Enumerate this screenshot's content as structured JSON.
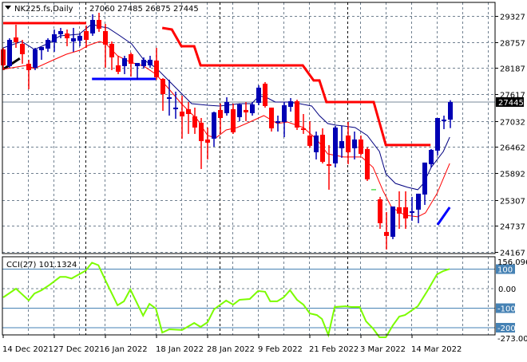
{
  "header": {
    "symbol": "NK225.fs,Daily",
    "ohlc": "27060 27485 26875 27445"
  },
  "colors": {
    "bull": "#0000b4",
    "bear": "#ff0000",
    "ma_fast": "#000080",
    "ma_slow": "#ff0000",
    "cci": "#7cfc00",
    "level": "#4682b4",
    "grid": "#708090"
  },
  "chart_data": [
    {
      "type": "candlestick",
      "title": "NK225.fs,Daily",
      "ylim": [
        24167,
        29327
      ],
      "yticks": [
        "29327",
        "28757",
        "28187",
        "27617",
        "27032",
        "26462",
        "25892",
        "25307",
        "24737",
        "24167"
      ],
      "current_price": "27445",
      "xticks": [
        {
          "index": 0,
          "label": "14 Dec 2021"
        },
        {
          "index": 8,
          "label": "27 Dec 2021"
        },
        {
          "index": 16,
          "label": "6 Jan 2022"
        },
        {
          "index": 24,
          "label": "18 Jan 2022"
        },
        {
          "index": 32,
          "label": "28 Jan 2022"
        },
        {
          "index": 40,
          "label": "9 Feb 2022"
        },
        {
          "index": 48,
          "label": "21 Feb 2022"
        },
        {
          "index": 56,
          "label": "3 Mar 2022"
        },
        {
          "index": 64,
          "label": "14 Mar 2022"
        }
      ],
      "month_separators": [
        12.9,
        33.9,
        53.9
      ],
      "candles": [
        [
          28595,
          28630,
          28143,
          28247
        ],
        [
          28230,
          28839,
          28195,
          28804
        ],
        [
          28857,
          29136,
          28630,
          28752
        ],
        [
          28717,
          28804,
          28282,
          28491
        ],
        [
          28282,
          28369,
          27724,
          28143
        ],
        [
          28195,
          28630,
          28143,
          28595
        ],
        [
          28578,
          28647,
          28369,
          28647
        ],
        [
          28613,
          28839,
          28543,
          28804
        ],
        [
          28752,
          29031,
          28543,
          28927
        ],
        [
          28927,
          29066,
          28839,
          28996
        ],
        [
          28944,
          29031,
          28665,
          28839
        ],
        [
          28769,
          29066,
          28543,
          28839
        ],
        [
          28787,
          28944,
          28665,
          28892
        ],
        [
          28996,
          29118,
          28630,
          28804
        ],
        [
          28944,
          29362,
          28892,
          29240
        ],
        [
          29240,
          29397,
          28979,
          29048
        ],
        [
          28996,
          29153,
          28195,
          28700
        ],
        [
          28717,
          28769,
          28143,
          28421
        ],
        [
          28247,
          28456,
          28055,
          28107
        ],
        [
          28230,
          28456,
          28055,
          28404
        ],
        [
          28491,
          28526,
          28003,
          28282
        ],
        [
          28230,
          28299,
          27933,
          28299
        ],
        [
          28230,
          28421,
          28178,
          28369
        ],
        [
          28247,
          28456,
          28195,
          28369
        ],
        [
          28352,
          28630,
          27933,
          27985
        ],
        [
          27950,
          27968,
          27253,
          27619
        ],
        [
          27515,
          27933,
          27148,
          27549
        ],
        [
          27288,
          27672,
          27079,
          27323
        ],
        [
          27236,
          27584,
          26644,
          27131
        ],
        [
          27288,
          27445,
          26748,
          27183
        ],
        [
          27131,
          27323,
          26748,
          26887
        ],
        [
          26992,
          27096,
          25981,
          26591
        ],
        [
          26626,
          26887,
          26190,
          26556
        ],
        [
          26644,
          27236,
          26469,
          27219
        ],
        [
          27271,
          27410,
          26765,
          27096
        ],
        [
          27201,
          27549,
          27148,
          27445
        ],
        [
          27288,
          27410,
          26748,
          26783
        ],
        [
          27114,
          27410,
          27026,
          27393
        ],
        [
          27271,
          27445,
          27026,
          27219
        ],
        [
          27201,
          27445,
          27148,
          27393
        ],
        [
          27427,
          27811,
          27375,
          27759
        ],
        [
          27846,
          27881,
          27323,
          27358
        ],
        [
          27323,
          27323,
          26800,
          26870
        ],
        [
          26992,
          27148,
          26800,
          27026
        ],
        [
          27009,
          27445,
          26678,
          27375
        ],
        [
          27340,
          27532,
          27236,
          27462
        ],
        [
          27462,
          27497,
          26835,
          26887
        ],
        [
          26870,
          27183,
          26748,
          26835
        ],
        [
          26713,
          27026,
          26452,
          26487
        ],
        [
          26347,
          26800,
          26190,
          26713
        ],
        [
          26730,
          26870,
          26103,
          26138
        ],
        [
          26086,
          26504,
          25528,
          26068
        ],
        [
          26103,
          26922,
          26016,
          26887
        ],
        [
          26434,
          26922,
          26225,
          26591
        ],
        [
          26713,
          27009,
          26086,
          26347
        ],
        [
          26434,
          26800,
          26190,
          26626
        ],
        [
          26626,
          26713,
          26277,
          26312
        ],
        [
          26417,
          26452,
          25719,
          25754
        ],
        [
          25528,
          25528,
          25528,
          25528
        ],
        [
          25318,
          25371,
          24673,
          24796
        ],
        [
          24604,
          25040,
          24221,
          24517
        ],
        [
          24499,
          25161,
          24447,
          25161
        ],
        [
          25144,
          25493,
          24673,
          25005
        ],
        [
          25144,
          25493,
          24673,
          24900
        ],
        [
          25022,
          25371,
          24848,
          25057
        ],
        [
          25092,
          25441,
          24796,
          25441
        ],
        [
          25423,
          26121,
          25196,
          26121
        ],
        [
          26086,
          26417,
          26016,
          26399
        ],
        [
          26382,
          27096,
          26277,
          27096
        ],
        [
          27026,
          27148,
          26852,
          27061
        ],
        [
          27060,
          27485,
          26875,
          27445
        ]
      ],
      "neutral_candles": [
        58
      ],
      "ma_fast": [
        [
          0,
          28630
        ],
        [
          2.9,
          28769
        ],
        [
          4.9,
          28595
        ],
        [
          6.9,
          28717
        ],
        [
          8.9,
          28892
        ],
        [
          11.9,
          28927
        ],
        [
          13.9,
          29153
        ],
        [
          14.9,
          29100
        ],
        [
          16.4,
          29066
        ],
        [
          18.3,
          28892
        ],
        [
          20.1,
          28717
        ],
        [
          22,
          28369
        ],
        [
          23.9,
          28195
        ],
        [
          27,
          27759
        ],
        [
          29.5,
          27410
        ],
        [
          32,
          27375
        ],
        [
          33.9,
          27358
        ],
        [
          37,
          27410
        ],
        [
          38.9,
          27410
        ],
        [
          40.1,
          27584
        ],
        [
          41.4,
          27532
        ],
        [
          42.6,
          27445
        ],
        [
          44.5,
          27445
        ],
        [
          46.4,
          27410
        ],
        [
          48.3,
          27358
        ],
        [
          49.5,
          27148
        ],
        [
          50.8,
          26975
        ],
        [
          52,
          26940
        ],
        [
          53.3,
          26922
        ],
        [
          55.1,
          26887
        ],
        [
          57,
          26713
        ],
        [
          58.9,
          26364
        ],
        [
          59.9,
          25876
        ],
        [
          61.4,
          25667
        ],
        [
          63.3,
          25580
        ],
        [
          64.9,
          25528
        ],
        [
          65.8,
          25667
        ],
        [
          67,
          26016
        ],
        [
          68.9,
          26364
        ],
        [
          69.9,
          26678
        ]
      ],
      "ma_slow": [
        [
          0,
          28160
        ],
        [
          3.6,
          28247
        ],
        [
          4.9,
          28178
        ],
        [
          7.9,
          28369
        ],
        [
          9.9,
          28491
        ],
        [
          12,
          28578
        ],
        [
          13.3,
          28682
        ],
        [
          15.1,
          28769
        ],
        [
          16.1,
          28717
        ],
        [
          17.9,
          28456
        ],
        [
          19.9,
          28317
        ],
        [
          22,
          28230
        ],
        [
          23.9,
          28055
        ],
        [
          26.1,
          27706
        ],
        [
          27.9,
          27410
        ],
        [
          30.4,
          27061
        ],
        [
          32,
          26713
        ],
        [
          33.3,
          26661
        ],
        [
          34.9,
          26835
        ],
        [
          36.6,
          26887
        ],
        [
          38.6,
          27009
        ],
        [
          40.8,
          27148
        ],
        [
          42.9,
          26975
        ],
        [
          44.5,
          27009
        ],
        [
          47,
          26887
        ],
        [
          49.1,
          26626
        ],
        [
          50.8,
          26312
        ],
        [
          53.3,
          26243
        ],
        [
          56.1,
          26243
        ],
        [
          57.9,
          26016
        ],
        [
          59.5,
          25493
        ],
        [
          60.8,
          25144
        ],
        [
          62.9,
          24970
        ],
        [
          64.9,
          24935
        ],
        [
          66.1,
          25022
        ],
        [
          67.9,
          25441
        ],
        [
          69.9,
          26103
        ]
      ],
      "resistance": [
        [
          [
            0,
            29170
          ],
          [
            13,
            29170
          ]
        ],
        [
          [
            24.9,
            29066
          ],
          [
            26.4,
            29031
          ],
          [
            27.9,
            28665
          ],
          [
            29.9,
            28665
          ],
          [
            30.9,
            28247
          ],
          [
            46.9,
            28247
          ],
          [
            48.6,
            27916
          ],
          [
            49.5,
            27916
          ],
          [
            50.6,
            27445
          ],
          [
            58,
            27445
          ],
          [
            59.9,
            26504
          ],
          [
            66.9,
            26504
          ]
        ]
      ],
      "support": [
        [
          [
            13.9,
            27950
          ],
          [
            23.9,
            27950
          ]
        ],
        [
          [
            68,
            24761
          ],
          [
            69.9,
            25144
          ]
        ]
      ],
      "trendline": [
        [
          0,
          28160
        ],
        [
          2.6,
          28400
        ]
      ]
    },
    {
      "type": "line",
      "title": "CCI(27) 101.1324",
      "ylim": [
        -273.0024,
        156.0965
      ],
      "max_label": "156.0965",
      "min_label": "-273.0024",
      "zero_label": "0.00",
      "levels": [
        "100",
        "-100",
        "-200"
      ],
      "points": [
        [
          0,
          -45
        ],
        [
          2,
          0
        ],
        [
          4,
          -60
        ],
        [
          4.9,
          -25
        ],
        [
          6,
          -8
        ],
        [
          7.3,
          20
        ],
        [
          8.9,
          60
        ],
        [
          9.8,
          60
        ],
        [
          10.7,
          52
        ],
        [
          11.6,
          68
        ],
        [
          12.9,
          92
        ],
        [
          13.9,
          133
        ],
        [
          14.9,
          120
        ],
        [
          16.1,
          36
        ],
        [
          17.9,
          -85
        ],
        [
          18.9,
          -65
        ],
        [
          19.9,
          -4
        ],
        [
          21.9,
          -138
        ],
        [
          22.9,
          -78
        ],
        [
          23.9,
          -102
        ],
        [
          24.9,
          -225
        ],
        [
          26,
          -208
        ],
        [
          28,
          -212
        ],
        [
          29.9,
          -176
        ],
        [
          30.9,
          -196
        ],
        [
          32,
          -172
        ],
        [
          33,
          -106
        ],
        [
          34.9,
          -61
        ],
        [
          36,
          -82
        ],
        [
          37,
          -57
        ],
        [
          38.6,
          -53
        ],
        [
          39.9,
          -12
        ],
        [
          41,
          -16
        ],
        [
          41.8,
          -65
        ],
        [
          42.9,
          -65
        ],
        [
          43.9,
          -45
        ],
        [
          44.9,
          -8
        ],
        [
          46,
          -57
        ],
        [
          47,
          -82
        ],
        [
          48,
          -127
        ],
        [
          49.1,
          -135
        ],
        [
          49.9,
          -155
        ],
        [
          50.9,
          -237
        ],
        [
          51.9,
          -94
        ],
        [
          53.6,
          -90
        ],
        [
          54.5,
          -94
        ],
        [
          55.8,
          -94
        ],
        [
          56.8,
          -167
        ],
        [
          57.9,
          -204
        ],
        [
          58.9,
          -249
        ],
        [
          59.9,
          -249
        ],
        [
          61,
          -188
        ],
        [
          62,
          -143
        ],
        [
          62.9,
          -135
        ],
        [
          64.9,
          -90
        ],
        [
          66.4,
          -12
        ],
        [
          67.9,
          73
        ],
        [
          68.9,
          90
        ],
        [
          69.9,
          101
        ]
      ]
    }
  ]
}
